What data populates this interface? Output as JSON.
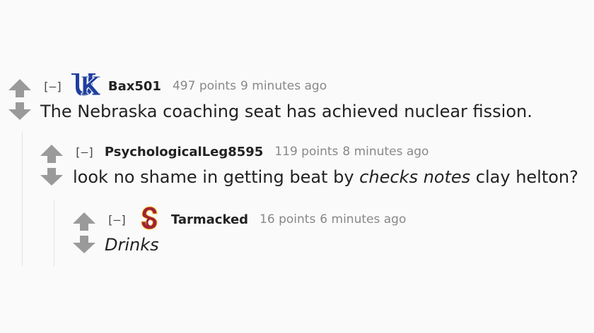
{
  "comments": [
    {
      "collapse_label": "[–]",
      "flair": "kentucky-wildcats-logo",
      "author": "Bax501",
      "score": "497 points",
      "time": "9 minutes ago",
      "body": "The Nebraska coaching seat has achieved nuclear fission."
    },
    {
      "collapse_label": "[–]",
      "author": "PsychologicalLeg8595",
      "score": "119 points",
      "time": "8 minutes ago",
      "body_before": "look no shame in getting beat by ",
      "body_em": "checks notes",
      "body_after": " clay helton?"
    },
    {
      "collapse_label": "[–]",
      "flair": "usc-trojans-logo",
      "author": "Tarmacked",
      "score": "16 points",
      "time": "6 minutes ago",
      "body_em": "Drinks"
    }
  ],
  "colors": {
    "arrow": "#9a9a9a",
    "text": "#222222",
    "meta": "#888888",
    "uk_blue": "#1f3f9e",
    "usc_cardinal": "#9d2235",
    "usc_gold": "#ffc72c"
  }
}
